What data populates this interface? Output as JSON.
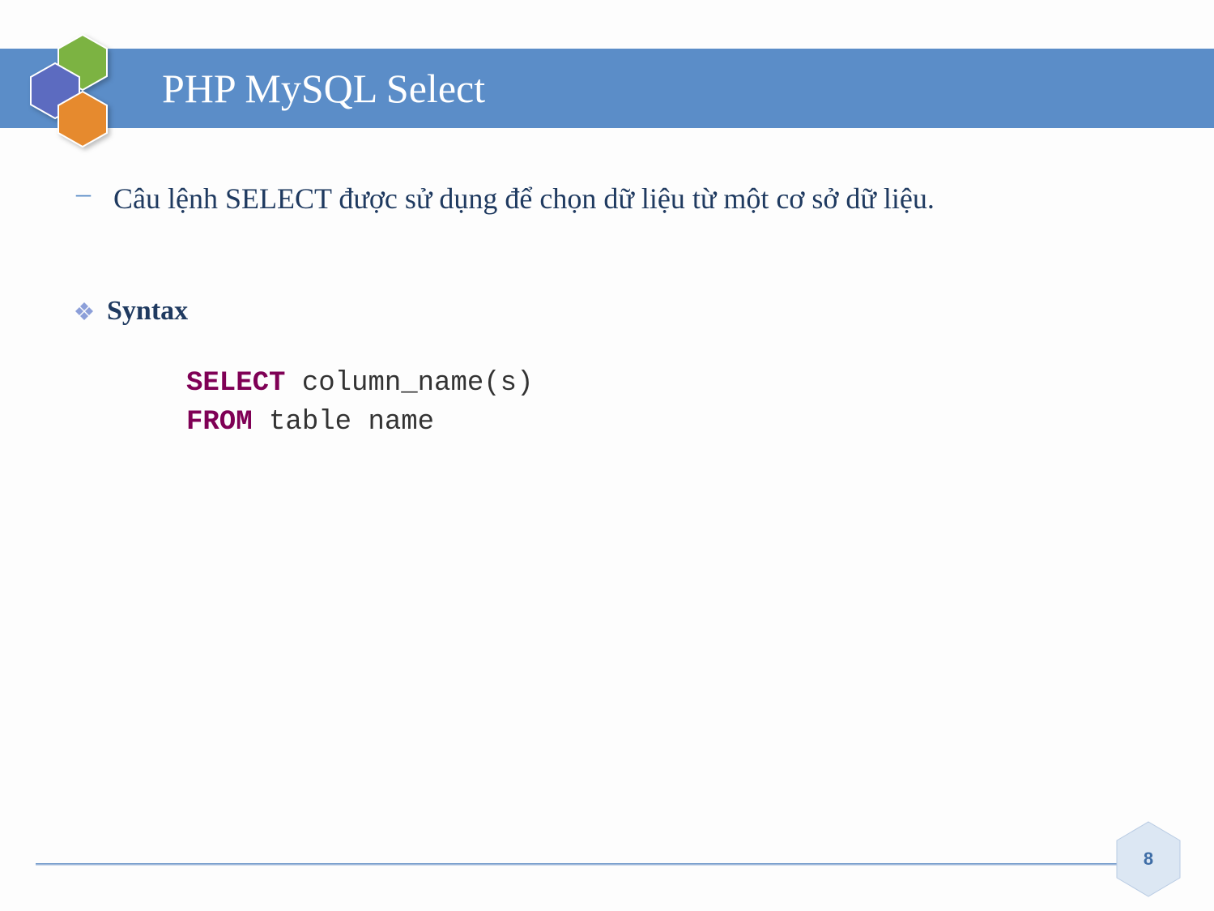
{
  "header": {
    "title": "PHP MySQL Select"
  },
  "content": {
    "bullet": "Câu lệnh SELECT được sử dụng để chọn dữ liệu từ một cơ sở dữ liệu.",
    "syntax_label": "Syntax",
    "code": {
      "kw1": "SELECT",
      "line1_rest": " column_name(s)",
      "kw2": "FROM",
      "line2_rest": " table name"
    }
  },
  "footer": {
    "page_number": "8"
  }
}
